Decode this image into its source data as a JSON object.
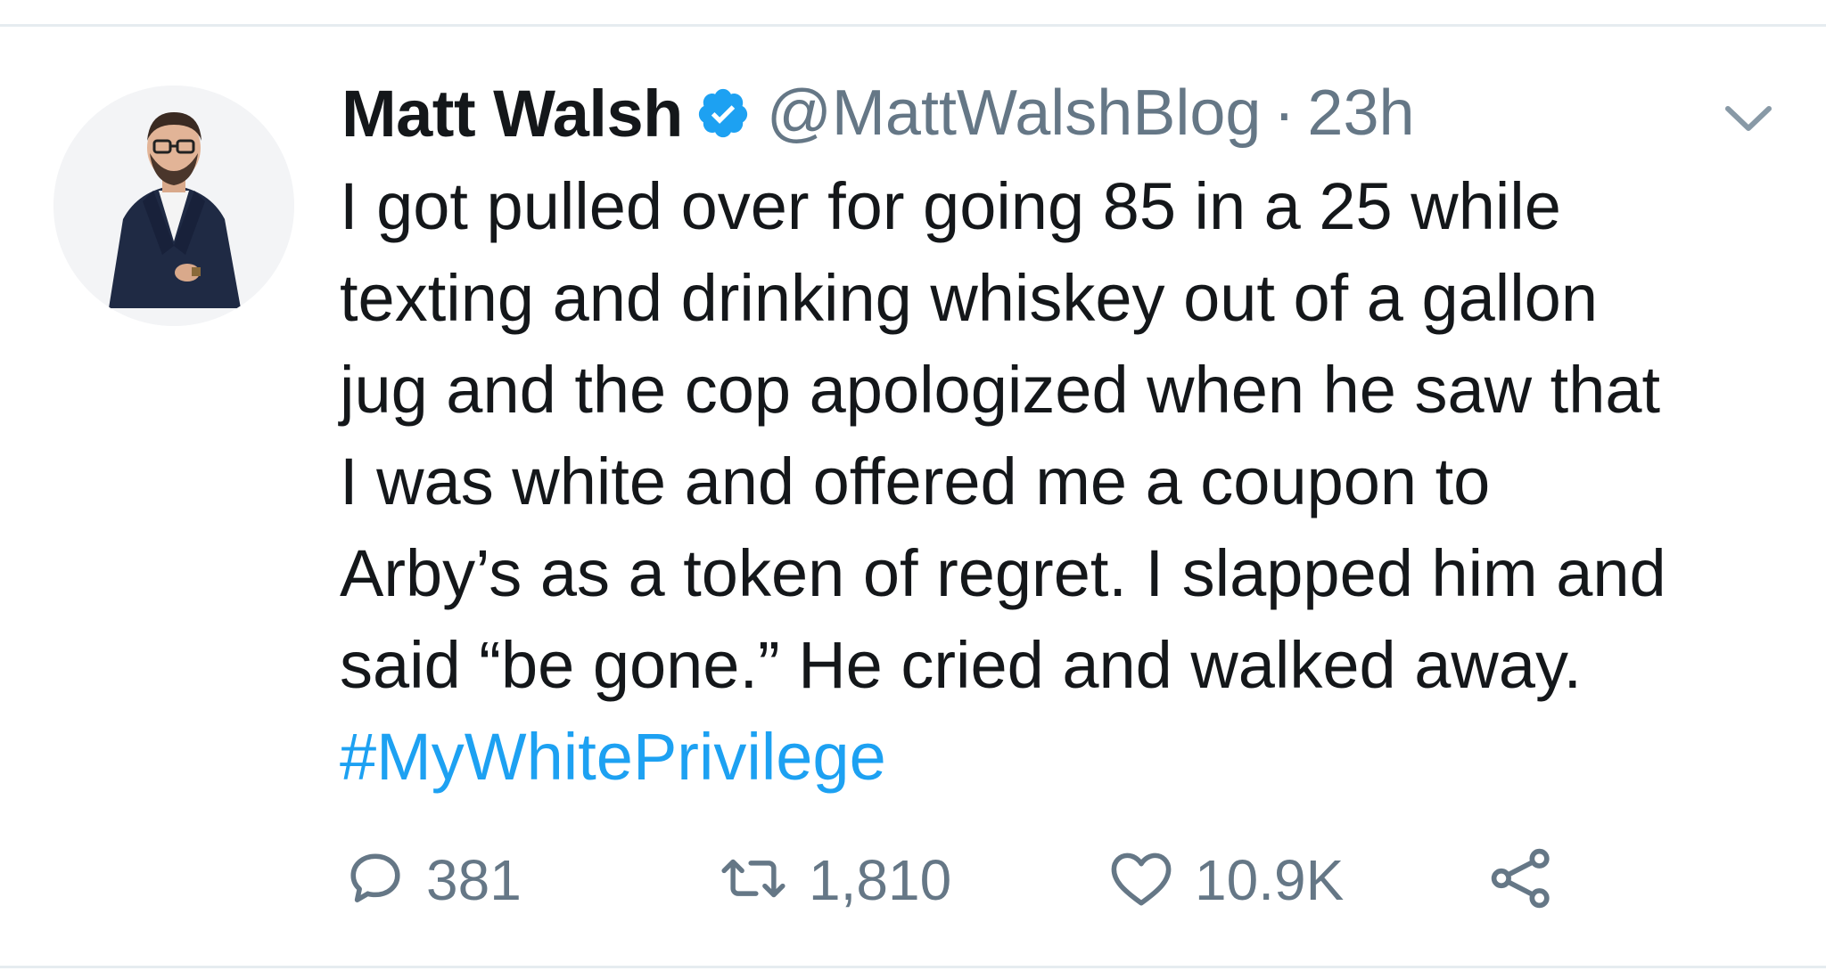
{
  "tweet": {
    "author_name": "Matt Walsh",
    "handle": "@MattWalshBlog",
    "separator": "·",
    "time": "23h",
    "verified": true,
    "body_lines": [
      "I got pulled over for going 85 in a 25 while",
      "texting and drinking whiskey out of a gallon",
      "jug and the cop apologized when he saw that",
      "I was white and offered me a coupon to",
      "Arby’s as a token of regret. I slapped him and",
      "said “be gone.” He cried and walked away."
    ],
    "hashtag": "#MyWhitePrivilege",
    "stats": {
      "replies": "381",
      "retweets": "1,810",
      "likes": "10.9K"
    }
  },
  "icons": {
    "verified": "verified-badge-icon",
    "menu": "chevron-down-icon",
    "reply": "reply-icon",
    "retweet": "retweet-icon",
    "like": "heart-icon",
    "share": "share-icon"
  },
  "colors": {
    "text": "#14171a",
    "secondary": "#657786",
    "accent": "#1da1f2",
    "divider": "#e6ecf0"
  }
}
